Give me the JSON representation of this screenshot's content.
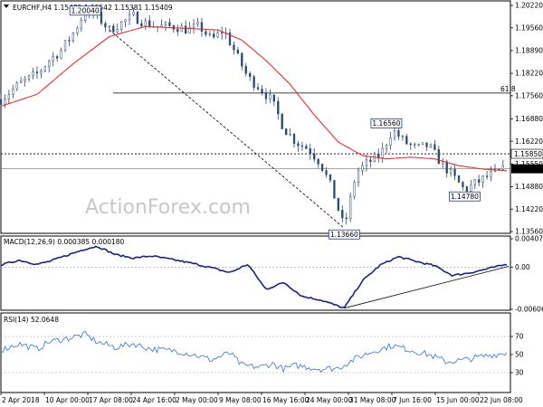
{
  "header": {
    "symbol_line": "EURCHF,H4  1.15485 1.15542 1.15381 1.15409"
  },
  "watermark": "ActionForex.com",
  "colors": {
    "candles": "#2a4a6e",
    "ma": "#e83030",
    "macd": "#1a237e",
    "rsi": "#2f6fe0",
    "price_box": "#000000",
    "level_box": "#1f3a93"
  },
  "chart_data": [
    {
      "type": "candlestick",
      "name": "price",
      "title": "EURCHF,H4",
      "ylim": [
        1.1356,
        1.2022
      ],
      "y_ticks": [
        "1.20220",
        "1.19560",
        "1.18890",
        "1.18220",
        "1.17560",
        "1.16880",
        "1.16220",
        "1.15550",
        "1.14880",
        "1.14220",
        "1.13560"
      ],
      "current_price": "1.15409",
      "level_box": "1.15850",
      "overlay_ma": "red moving average",
      "horizontal_lines": [
        {
          "value": 1.1764,
          "label": "61.8",
          "style": "solid"
        },
        {
          "value": 1.1585,
          "label": "",
          "style": "dotted"
        }
      ],
      "labeled_points": [
        {
          "label": "1.20040",
          "x": "16 Apr",
          "y": 1.2004
        },
        {
          "label": "1.16560",
          "x": "5 Jun",
          "y": 1.1656
        },
        {
          "label": "1.14780",
          "x": "18 Jun",
          "y": 1.1478
        },
        {
          "label": "1.13660",
          "x": "29 May",
          "y": 1.1366
        }
      ],
      "trendlines": [
        {
          "from": [
            "20 Apr",
            1.195
          ],
          "to": [
            "29 May",
            1.1366
          ],
          "style": "dashed"
        }
      ],
      "path": [
        [
          "2 Apr",
          1.1745
        ],
        [
          "5 Apr",
          1.179
        ],
        [
          "8 Apr",
          1.182
        ],
        [
          "10 Apr",
          1.186
        ],
        [
          "12 Apr",
          1.189
        ],
        [
          "14 Apr",
          1.194
        ],
        [
          "16 Apr",
          1.2004
        ],
        [
          "18 Apr",
          1.199
        ],
        [
          "20 Apr",
          1.195
        ],
        [
          "22 Apr",
          1.197
        ],
        [
          "24 Apr",
          1.199
        ],
        [
          "26 Apr",
          1.197
        ],
        [
          "28 Apr",
          1.196
        ],
        [
          "1 May",
          1.196
        ],
        [
          "3 May",
          1.195
        ],
        [
          "5 May",
          1.196
        ],
        [
          "7 May",
          1.192
        ],
        [
          "9 May",
          1.195
        ],
        [
          "11 May",
          1.188
        ],
        [
          "13 May",
          1.181
        ],
        [
          "15 May",
          1.178
        ],
        [
          "17 May",
          1.174
        ],
        [
          "19 May",
          1.166
        ],
        [
          "21 May",
          1.162
        ],
        [
          "23 May",
          1.16
        ],
        [
          "25 May",
          1.156
        ],
        [
          "27 May",
          1.148
        ],
        [
          "29 May",
          1.1366
        ],
        [
          "31 May",
          1.153
        ],
        [
          "2 Jun",
          1.156
        ],
        [
          "4 Jun",
          1.158
        ],
        [
          "6 Jun",
          1.1656
        ],
        [
          "8 Jun",
          1.162
        ],
        [
          "10 Jun",
          1.16
        ],
        [
          "12 Jun",
          1.161
        ],
        [
          "14 Jun",
          1.156
        ],
        [
          "16 Jun",
          1.152
        ],
        [
          "18 Jun",
          1.1478
        ],
        [
          "20 Jun",
          1.15
        ],
        [
          "22 Jun",
          1.152
        ],
        [
          "25 Jun",
          1.1541
        ]
      ],
      "ma_path": [
        [
          "2 Apr",
          1.1725
        ],
        [
          "8 Apr",
          1.176
        ],
        [
          "14 Apr",
          1.185
        ],
        [
          "20 Apr",
          1.193
        ],
        [
          "26 Apr",
          1.196
        ],
        [
          "2 May",
          1.1955
        ],
        [
          "8 May",
          1.195
        ],
        [
          "12 May",
          1.192
        ],
        [
          "16 May",
          1.186
        ],
        [
          "20 May",
          1.179
        ],
        [
          "24 May",
          1.17
        ],
        [
          "28 May",
          1.162
        ],
        [
          "1 Jun",
          1.158
        ],
        [
          "5 Jun",
          1.157
        ],
        [
          "9 Jun",
          1.1575
        ],
        [
          "13 Jun",
          1.157
        ],
        [
          "17 Jun",
          1.155
        ],
        [
          "21 Jun",
          1.154
        ],
        [
          "25 Jun",
          1.1535
        ]
      ]
    },
    {
      "type": "line",
      "name": "macd",
      "title": "MACD(12,26,9) 0.000385 0.000180",
      "ylim": [
        -0.006069,
        0.004071
      ],
      "y_ticks": [
        "0.004071",
        "0.00",
        "-0.006069"
      ],
      "trendlines": [
        {
          "from": [
            "29 May",
            -0.0059
          ],
          "to": [
            "25 Jun",
            0.0001
          ],
          "style": "solid"
        }
      ],
      "path": [
        [
          "2 Apr",
          0.0003
        ],
        [
          "5 Apr",
          0.001
        ],
        [
          "8 Apr",
          0.0004
        ],
        [
          "10 Apr",
          0.0008
        ],
        [
          "13 Apr",
          0.0017
        ],
        [
          "16 Apr",
          0.0026
        ],
        [
          "18 Apr",
          0.003
        ],
        [
          "21 Apr",
          0.0018
        ],
        [
          "24 Apr",
          0.0013
        ],
        [
          "27 Apr",
          0.0016
        ],
        [
          "1 May",
          0.001
        ],
        [
          "4 May",
          0.0005
        ],
        [
          "7 May",
          -0.0001
        ],
        [
          "10 May",
          -0.0008
        ],
        [
          "13 May",
          0.0004
        ],
        [
          "16 May",
          -0.0032
        ],
        [
          "19 May",
          -0.0022
        ],
        [
          "22 May",
          -0.0042
        ],
        [
          "25 May",
          -0.0047
        ],
        [
          "29 May",
          -0.0059
        ],
        [
          "1 Jun",
          -0.002
        ],
        [
          "4 Jun",
          0.0003
        ],
        [
          "7 Jun",
          0.0015
        ],
        [
          "10 Jun",
          0.0008
        ],
        [
          "13 Jun",
          0.0002
        ],
        [
          "16 Jun",
          -0.0012
        ],
        [
          "19 Jun",
          -0.0008
        ],
        [
          "22 Jun",
          -0.0002
        ],
        [
          "25 Jun",
          0.0004
        ]
      ]
    },
    {
      "type": "line",
      "name": "rsi",
      "title": "RSI(14) 52.0648",
      "ylim": [
        0,
        100
      ],
      "y_ticks": [
        "70",
        "50",
        "30"
      ],
      "reference_lines": [
        70,
        30
      ],
      "path": [
        [
          "2 Apr",
          55
        ],
        [
          "5 Apr",
          62
        ],
        [
          "8 Apr",
          56
        ],
        [
          "10 Apr",
          64
        ],
        [
          "13 Apr",
          68
        ],
        [
          "16 Apr",
          72
        ],
        [
          "18 Apr",
          64
        ],
        [
          "21 Apr",
          58
        ],
        [
          "24 Apr",
          62
        ],
        [
          "27 Apr",
          56
        ],
        [
          "1 May",
          54
        ],
        [
          "4 May",
          50
        ],
        [
          "7 May",
          44
        ],
        [
          "10 May",
          52
        ],
        [
          "12 May",
          38
        ],
        [
          "15 May",
          36
        ],
        [
          "17 May",
          40
        ],
        [
          "19 May",
          34
        ],
        [
          "21 May",
          38
        ],
        [
          "23 May",
          36
        ],
        [
          "25 May",
          34
        ],
        [
          "28 May",
          35
        ],
        [
          "31 May",
          46
        ],
        [
          "3 Jun",
          54
        ],
        [
          "6 Jun",
          60
        ],
        [
          "9 Jun",
          55
        ],
        [
          "12 Jun",
          50
        ],
        [
          "15 Jun",
          42
        ],
        [
          "18 Jun",
          44
        ],
        [
          "21 Jun",
          48
        ],
        [
          "25 Jun",
          52
        ]
      ]
    }
  ],
  "x_axis": {
    "ticks": [
      "2 Apr 2018",
      "10 Apr 00:00",
      "17 Apr 08:00",
      "24 Apr 16:00",
      "2 May 00:00",
      "9 May 08:00",
      "16 May 16:00",
      "24 May 00:00",
      "31 May 08:00",
      "7 Jun 16:00",
      "15 Jun 00:00",
      "22 Jun 08:00"
    ]
  }
}
